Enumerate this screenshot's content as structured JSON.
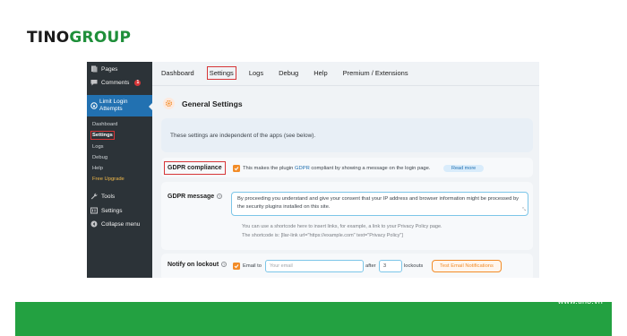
{
  "brand": {
    "part1": "TINO",
    "part2": "GROUP"
  },
  "sidebar": {
    "top_items": [
      {
        "label": "Pages",
        "icon": "pages-icon"
      },
      {
        "label": "Comments",
        "icon": "comments-icon",
        "badge": "1"
      }
    ],
    "active_item": {
      "label": "Limit Login Attempts",
      "icon": "lock-icon"
    },
    "submenu": [
      "Dashboard",
      "Settings",
      "Logs",
      "Debug",
      "Help",
      "Free Upgrade"
    ],
    "bottom_items": [
      {
        "label": "Tools",
        "icon": "wrench-icon"
      },
      {
        "label": "Settings",
        "icon": "settings-icon"
      },
      {
        "label": "Collapse menu",
        "icon": "collapse-icon"
      }
    ]
  },
  "tabs": [
    "Dashboard",
    "Settings",
    "Logs",
    "Debug",
    "Help",
    "Premium / Extensions"
  ],
  "active_tab": "Settings",
  "section": {
    "title": "General Settings"
  },
  "info": "These settings are independent of the apps (see below).",
  "gdpr": {
    "label": "GDPR compliance",
    "checked": true,
    "text_before": "This makes the plugin",
    "link": "GDPR",
    "text_after": "compliant by showing a message on the login page.",
    "read_more": "Read more"
  },
  "gdpr_message": {
    "label": "GDPR message",
    "value": "By proceeding you understand and give your consent that your IP address and browser information might be processed by the security plugins installed on this site.",
    "hint1": "You can use a shortcode here to insert links, for example, a link to your Privacy Policy page.",
    "hint2": "The shortcode is: [llar-link url=\"https://example.com\" text=\"Privacy Policy\"]"
  },
  "notify": {
    "label": "Notify on lockout",
    "checked": true,
    "email_to": "Email to",
    "email_placeholder": "Your email",
    "after": "after",
    "count": "3",
    "lockouts": "lockouts",
    "button": "Test Email Notifications"
  },
  "footer": {
    "url": "www.tino.vn"
  },
  "colors": {
    "brand_green": "#23a141",
    "wp_blue": "#2271b1",
    "accent_orange": "#f28c28",
    "highlight_red": "#d63638"
  }
}
